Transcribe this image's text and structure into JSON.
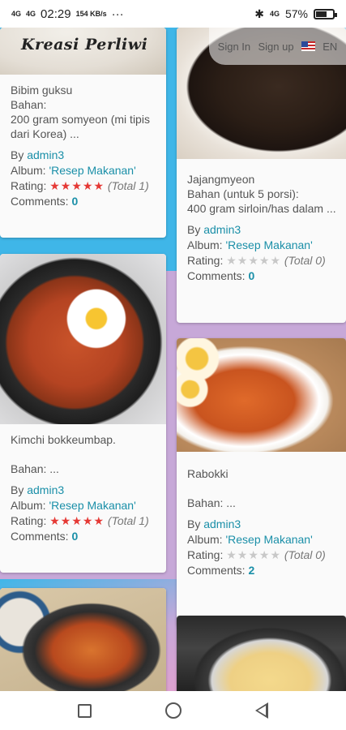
{
  "status_bar": {
    "time": "02:29",
    "net_speed": "154 KB/s",
    "signal_left": "4G",
    "signal_right": "4G",
    "battery": "57%",
    "overflow": "···"
  },
  "header": {
    "logo": "Kreasi Perliwi",
    "sign_in": "Sign In",
    "sign_up": "Sign up",
    "language": "EN"
  },
  "labels": {
    "by": "By",
    "album": "Album:",
    "rating": "Rating:",
    "comments": "Comments:"
  },
  "cards": [
    {
      "title": "Bibim guksu",
      "desc": "Bahan:\n200 gram somyeon (mi tipis dari Korea) ...",
      "author": "admin3",
      "album": "'Resep Makanan'",
      "stars": "★★★★★",
      "rating_total": "(Total 1)",
      "comments": "0"
    },
    {
      "title": "Jajangmyeon",
      "desc": "Bahan (untuk 5 porsi):\n400 gram sirloin/has dalam ...",
      "author": "admin3",
      "album": "'Resep Makanan'",
      "stars": "★★★★★",
      "rating_total": "(Total 0)",
      "comments": "0"
    },
    {
      "title": "Kimchi bokkeumbap.",
      "desc": "Bahan: ...",
      "author": "admin3",
      "album": "'Resep Makanan'",
      "stars": "★★★★★",
      "rating_total": "(Total 1)",
      "comments": "0"
    },
    {
      "title": "Rabokki",
      "desc": "Bahan: ...",
      "author": "admin3",
      "album": "'Resep Makanan'",
      "stars": "★★★★★",
      "rating_total": "(Total 0)",
      "comments": "2"
    }
  ],
  "colors": {
    "link": "#1a8fa8",
    "star_active": "#e53935",
    "star_inactive": "#c8c8c8",
    "band_blue": "#3fb6e8",
    "band_purple": "#c7a8d8",
    "band_pink": "#f49ac8"
  },
  "nav": {
    "recent": "square-icon",
    "home": "circle-icon",
    "back": "back-triangle-icon"
  }
}
